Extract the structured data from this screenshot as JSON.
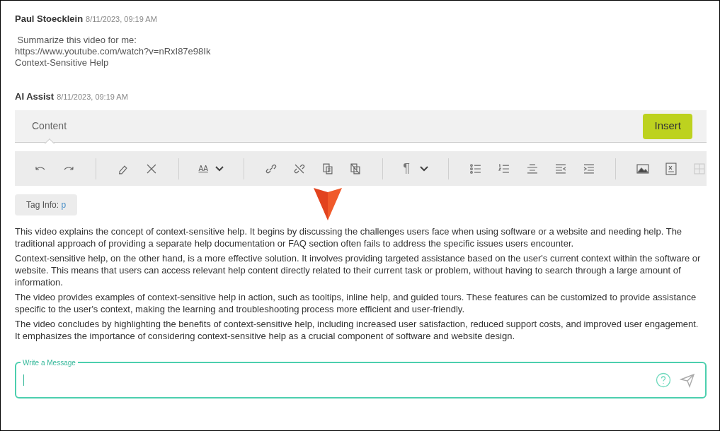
{
  "messages": [
    {
      "author": "Paul Stoecklein",
      "time": "8/11/2023, 09:19 AM",
      "lines": [
        " Summarize this video for me:",
        "https://www.youtube.com/watch?v=nRxI87e98Ik",
        "Context-Sensitive Help"
      ]
    },
    {
      "author": "AI Assist",
      "time": "8/11/2023, 09:19 AM"
    }
  ],
  "editor": {
    "tabs": [
      {
        "label": "Content",
        "selected": true
      }
    ],
    "insert_button": "Insert",
    "toolbar": {
      "font_size_label": "AA",
      "paragraph_label": "¶",
      "table_disabled": true
    },
    "tag_info": {
      "label": "Tag Info:",
      "value": "p"
    },
    "paragraphs": [
      "This video explains the concept of context-sensitive help. It begins by discussing the challenges users face when using software or a website and needing help. The traditional approach of providing a separate help documentation or FAQ section often fails to address the specific issues users encounter.",
      "Context-sensitive help, on the other hand, is a more effective solution. It involves providing targeted assistance based on the user's current context within the software or website. This means that users can access relevant help content directly related to their current task or problem, without having to search through a large amount of information.",
      "The video provides examples of context-sensitive help in action, such as tooltips, inline help, and guided tours. These features can be customized to provide assistance specific to the user's context, making the learning and troubleshooting process more efficient and user-friendly.",
      "The video concludes by highlighting the benefits of context-sensitive help, including increased user satisfaction, reduced support costs, and improved user engagement. It emphasizes the importance of considering context-sensitive help as a crucial component of software and website design."
    ]
  },
  "composer": {
    "label": "Write a Message"
  }
}
